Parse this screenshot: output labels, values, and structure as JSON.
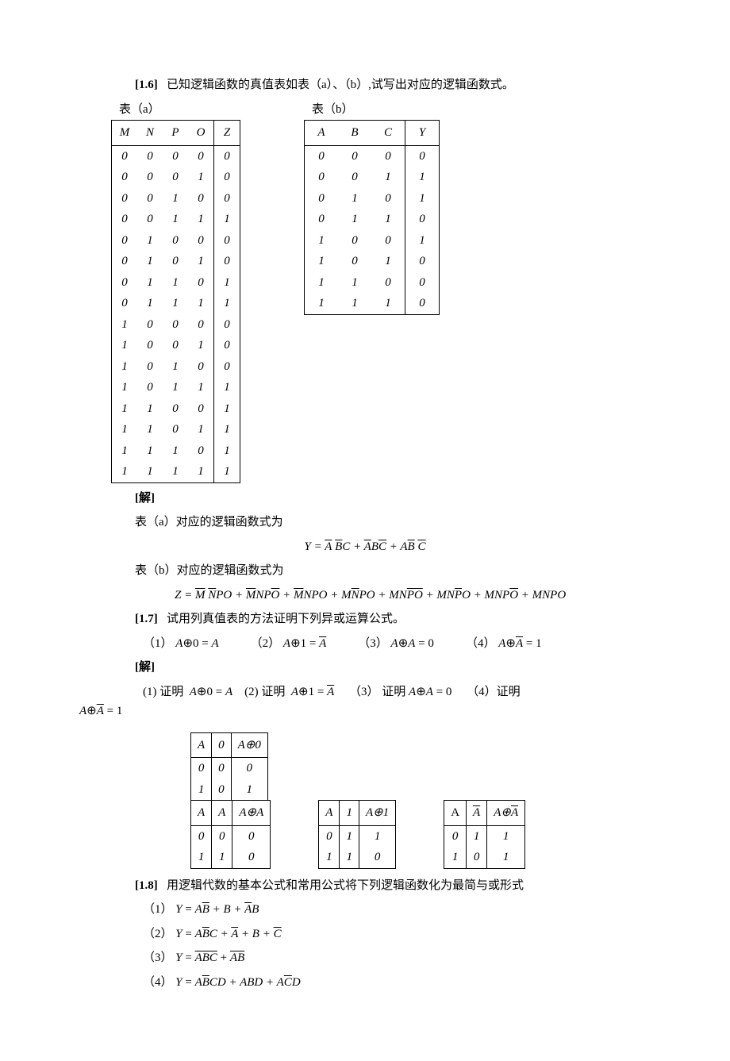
{
  "p1_6": {
    "label": "[1.6]",
    "text": "已知逻辑函数的真值表如表（a）、（b）,试写出对应的逻辑函数式。",
    "table_a": {
      "caption": "表（a）",
      "headers": [
        "M",
        "N",
        "P",
        "O",
        "Z"
      ],
      "rows": [
        [
          "0",
          "0",
          "0",
          "0",
          "0"
        ],
        [
          "0",
          "0",
          "0",
          "1",
          "0"
        ],
        [
          "0",
          "0",
          "1",
          "0",
          "0"
        ],
        [
          "0",
          "0",
          "1",
          "1",
          "1"
        ],
        [
          "0",
          "1",
          "0",
          "0",
          "0"
        ],
        [
          "0",
          "1",
          "0",
          "1",
          "0"
        ],
        [
          "0",
          "1",
          "1",
          "0",
          "1"
        ],
        [
          "0",
          "1",
          "1",
          "1",
          "1"
        ],
        [
          "1",
          "0",
          "0",
          "0",
          "0"
        ],
        [
          "1",
          "0",
          "0",
          "1",
          "0"
        ],
        [
          "1",
          "0",
          "1",
          "0",
          "0"
        ],
        [
          "1",
          "0",
          "1",
          "1",
          "1"
        ],
        [
          "1",
          "1",
          "0",
          "0",
          "1"
        ],
        [
          "1",
          "1",
          "0",
          "1",
          "1"
        ],
        [
          "1",
          "1",
          "1",
          "0",
          "1"
        ],
        [
          "1",
          "1",
          "1",
          "1",
          "1"
        ]
      ]
    },
    "table_b": {
      "caption": "表（b）",
      "headers": [
        "A",
        "B",
        "C",
        "Y"
      ],
      "rows": [
        [
          "0",
          "0",
          "0",
          "0"
        ],
        [
          "0",
          "0",
          "1",
          "1"
        ],
        [
          "0",
          "1",
          "0",
          "1"
        ],
        [
          "0",
          "1",
          "1",
          "0"
        ],
        [
          "1",
          "0",
          "0",
          "1"
        ],
        [
          "1",
          "0",
          "1",
          "0"
        ],
        [
          "1",
          "1",
          "0",
          "0"
        ],
        [
          "1",
          "1",
          "1",
          "0"
        ]
      ]
    },
    "solution_label": "[解]",
    "sol_a_text": "表（a）对应的逻辑函数式为",
    "sol_a_eq": "Y = ĀB̄C + ĀBC̄ + AB̄C̄",
    "sol_b_text": "表（b）对应的逻辑函数式为",
    "sol_b_eq": "Z = M̄ N̄PO + M̄NPŌ + M̄NPO + MN̄PO + MNP̄Ō + MNP̄O + MNPŌ + MNPO"
  },
  "p1_7": {
    "label": "[1.7]",
    "text": "试用列真值表的方法证明下列异或运算公式。",
    "eq1": "（1） A⊕0 = A",
    "eq2": "（2） A⊕1 = Ā",
    "eq3": "（3） A⊕A = 0",
    "eq4": "（4） A⊕Ā = 1",
    "solution_label": "[解]",
    "proof_line": "(1) 证明 A⊕0=A   (2) 证明 A⊕1=Ā   （3） 证明 A⊕A=0   （4）证明 A⊕Ā=1",
    "mini1a": {
      "h": [
        "A",
        "0",
        "A⊕0"
      ],
      "r": [
        [
          "0",
          "0",
          "0"
        ],
        [
          "1",
          "0",
          "1"
        ]
      ]
    },
    "mini1b": {
      "h": [
        "A",
        "A",
        "A⊕A"
      ],
      "r": [
        [
          "0",
          "0",
          "0"
        ],
        [
          "1",
          "1",
          "0"
        ]
      ]
    },
    "mini2": {
      "h": [
        "A",
        "1",
        "A⊕1"
      ],
      "r": [
        [
          "0",
          "1",
          "1"
        ],
        [
          "1",
          "1",
          "0"
        ]
      ]
    },
    "mini3": {
      "h": [
        "A",
        "Ā",
        "A⊕Ā"
      ],
      "r": [
        [
          "0",
          "1",
          "1"
        ],
        [
          "1",
          "0",
          "1"
        ]
      ]
    }
  },
  "p1_8": {
    "label": "[1.8]",
    "text": "用逻辑代数的基本公式和常用公式将下列逻辑函数化为最简与或形式",
    "eq1": "（1） Y = AB̄ + B + ĀB",
    "eq2": "（2） Y = AB̄C + Ā + B + C̄",
    "eq3": "（3） Y = ¬(ĀBC) + ¬(AB̄)",
    "eq4": "（4） Y = AB̄CD + ABD + AC̄D"
  }
}
